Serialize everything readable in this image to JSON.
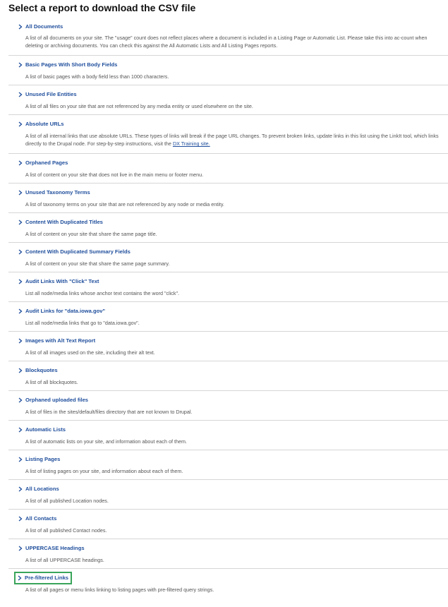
{
  "page": {
    "title": "Select a report to download the CSV file"
  },
  "reports": [
    {
      "label": "All Documents",
      "description": "A list of all documents on your site. The \"usage\" count does not reflect places where a document is included in a Listing Page or Automatic List. Please take this into ac-count when deleting or archiving documents. You can check this against the All Automatic Lists and All Listing Pages reports."
    },
    {
      "label": "Basic Pages With Short Body Fields",
      "description": "A list of basic pages with a body field less than 1000 characters."
    },
    {
      "label": "Unused File Entities",
      "description": "A list of all files on your site that are not referenced by any media entity or used elsewhere on the site."
    },
    {
      "label": "Absolute URLs",
      "description_before": "A list of all internal links that use absolute URLs. These types of links will break if the page URL changes. To prevent broken links, update links in this list using the LinkIt tool, which links directly to the Drupal node. For step-by-step instructions, visit the",
      "description_link": "DX Training site.",
      "description_after": ""
    },
    {
      "label": "Orphaned Pages",
      "description": "A list of content on your site that does not live in the main menu or footer menu."
    },
    {
      "label": "Unused Taxonomy Terms",
      "description": "A list of taxonomy terms on your site that are not referenced by any node or media entity."
    },
    {
      "label": "Content With Duplicated Titles",
      "description": "A list of content on your site that share the same page title."
    },
    {
      "label": "Content With Duplicated Summary Fields",
      "description": "A list of content on your site that share the same page summary."
    },
    {
      "label": "Audit Links With \"Click\" Text",
      "description": "List all node/media links whose anchor text contains the word \"click\"."
    },
    {
      "label": "Audit Links for \"data.iowa.gov\"",
      "description": "List all node/media links that go to \"data.iowa.gov\"."
    },
    {
      "label": "Images with Alt Text Report",
      "description": "A list of all images used on the site, including their alt text."
    },
    {
      "label": "Blockquotes",
      "description": "A list of all blockquotes."
    },
    {
      "label": "Orphaned uploaded files",
      "description": "A list of files in the sites/default/files directory that are not known to Drupal."
    },
    {
      "label": "Automatic Lists",
      "description": "A list of automatic lists on your site, and information about each of them."
    },
    {
      "label": "Listing Pages",
      "description": "A list of listing pages on your site, and information about each of them."
    },
    {
      "label": "All Locations",
      "description": "A list of all published Location nodes."
    },
    {
      "label": "All Contacts",
      "description": "A list of all published Contact nodes."
    },
    {
      "label": "UPPERCASE Headings",
      "description": "A list of all UPPERCASE headings."
    },
    {
      "label": "Pre-filtered Links",
      "description": "A list of all pages or menu links linking to listing pages with pre-filtered query strings."
    }
  ],
  "icons": {
    "link_icon": "chevron-right-icon"
  },
  "colors": {
    "link": "#1f4e9c",
    "focus_outline": "#3aa55b",
    "divider": "#d6d6d6"
  }
}
